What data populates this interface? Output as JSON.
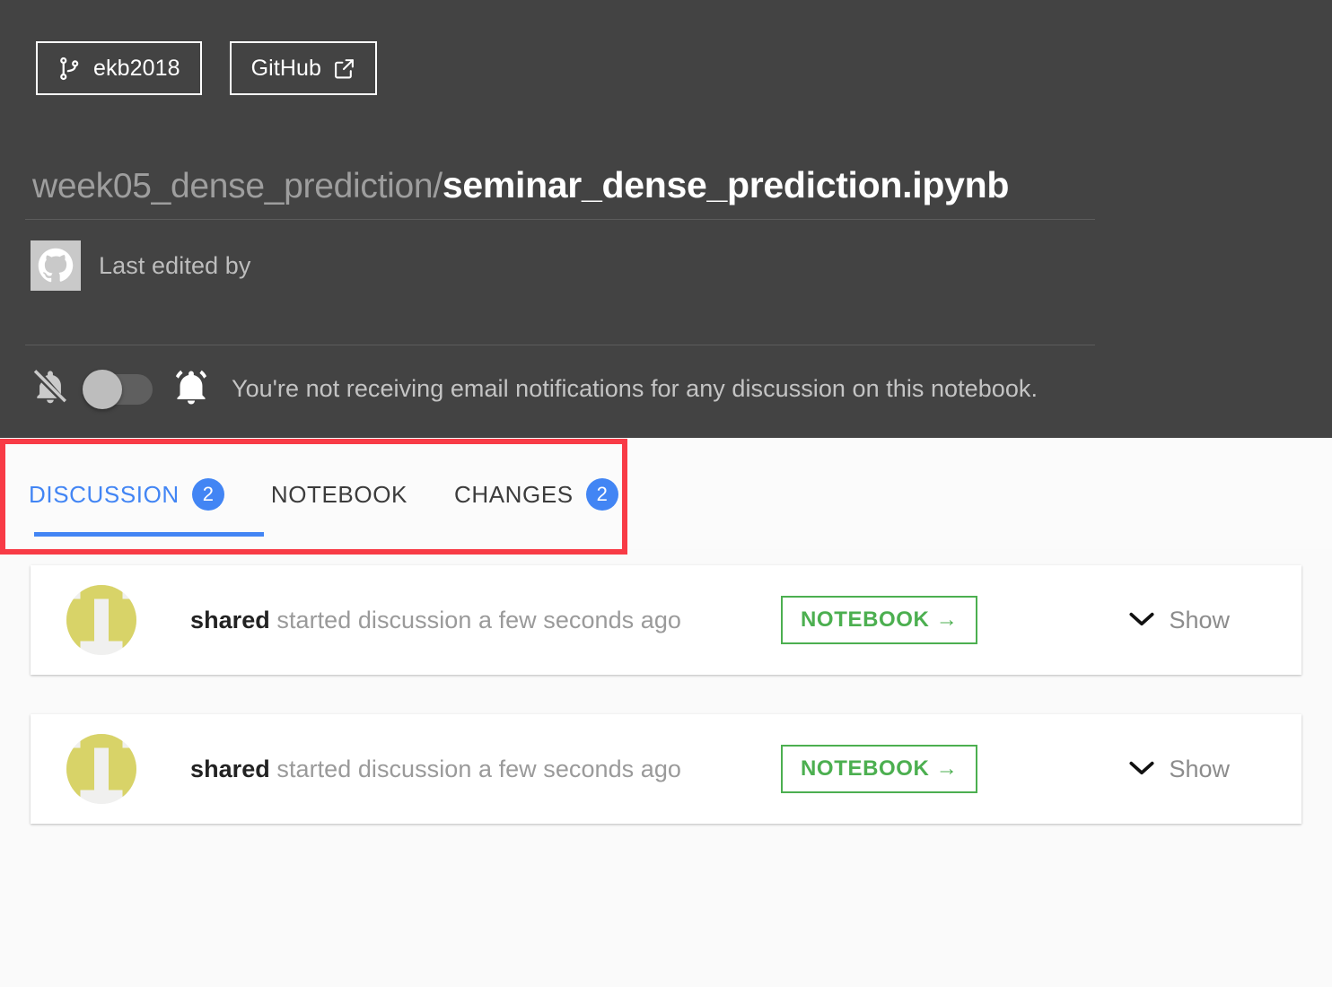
{
  "header": {
    "branch_button": {
      "label": "ekb2018",
      "icon": "branch-icon"
    },
    "github_button": {
      "label": "GitHub",
      "icon": "external-link-icon"
    },
    "title": {
      "path": "week05_dense_prediction/",
      "filename": "seminar_dense_prediction.ipynb"
    },
    "last_edited": {
      "label": "Last edited by",
      "avatar_icon": "github-octocat-icon"
    },
    "notifications": {
      "bell_off_icon": "bell-off-icon",
      "bell_on_icon": "bell-ring-icon",
      "toggle_state": "off",
      "message": "You're not receiving email notifications for any discussion on this notebook."
    }
  },
  "tabs": [
    {
      "label": "DISCUSSION",
      "badge": "2",
      "active": true,
      "name": "tab-discussion"
    },
    {
      "label": "NOTEBOOK",
      "badge": "",
      "active": false,
      "name": "tab-notebook"
    },
    {
      "label": "CHANGES",
      "badge": "2",
      "active": false,
      "name": "tab-changes"
    }
  ],
  "discussions": [
    {
      "author": "shared",
      "action": " started discussion a few seconds ago",
      "notebook_button": "NOTEBOOK →",
      "show_label": "Show",
      "chevron_icon": "chevron-down-icon",
      "avatar_icon": "identicon-avatar"
    },
    {
      "author": "shared",
      "action": " started discussion a few seconds ago",
      "notebook_button": "NOTEBOOK →",
      "show_label": "Show",
      "chevron_icon": "chevron-down-icon",
      "avatar_icon": "identicon-avatar"
    }
  ],
  "colors": {
    "header_bg": "#434343",
    "page_bg": "#fafafa",
    "accent_blue": "#4285f4",
    "accent_green": "#4caf50",
    "annotation_red": "#f83b46",
    "identicon_yellow": "#d8d368"
  }
}
